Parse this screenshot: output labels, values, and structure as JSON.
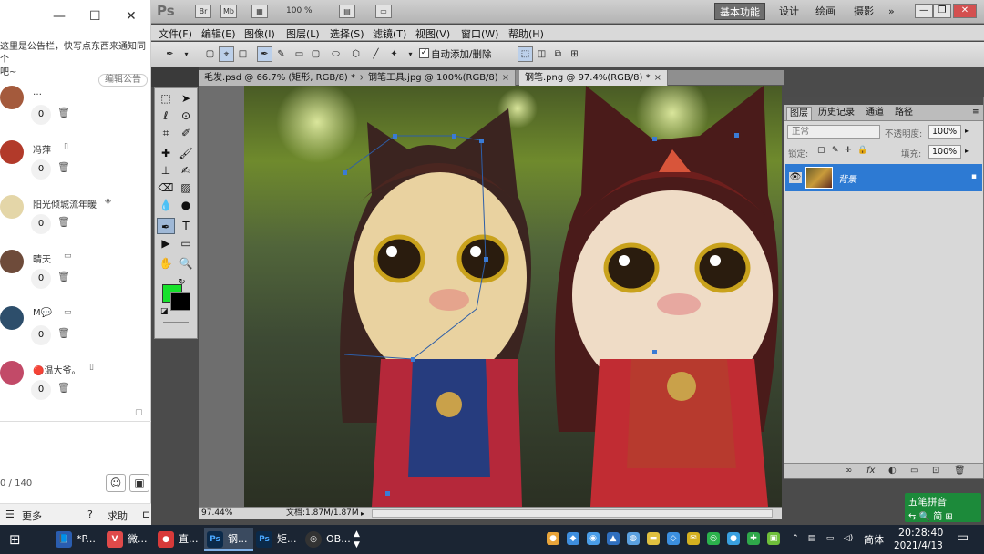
{
  "chat": {
    "window_controls": [
      "—",
      "☐",
      "✕"
    ],
    "notice_line1": "这里是公告栏，快写点东西来通知同个",
    "notice_line2": "吧~",
    "edit_notice": "编辑公告",
    "members": [
      {
        "name": "…",
        "count": "0",
        "avatar_color": "#a45a3c"
      },
      {
        "name": "冯萍",
        "count": "0",
        "avatar_color": "#b23a2a"
      },
      {
        "name": "阳光倾城流年暖",
        "count": "0",
        "avatar_color": "#e4d6a8"
      },
      {
        "name": "晴天",
        "count": "0",
        "avatar_color": "#6e4b3a"
      },
      {
        "name": "M💬",
        "count": "0",
        "avatar_color": "#2d4e6b"
      },
      {
        "name": "🔴温大爷。",
        "count": "0",
        "avatar_color": "#c24a68"
      }
    ],
    "counter": "0 / 140",
    "more_label": "更多",
    "help_label": "求助"
  },
  "ps": {
    "logo": "Ps",
    "appbar_buttons": [
      "Br",
      "Mb"
    ],
    "zoom": "100 %",
    "workspaces": [
      "基本功能",
      "设计",
      "绘画",
      "摄影"
    ],
    "active_workspace": "基本功能",
    "more_ws": "»",
    "window_buttons": [
      "—",
      "❐",
      "✕"
    ],
    "menu": [
      "文件(F)",
      "编辑(E)",
      "图像(I)",
      "图层(L)",
      "选择(S)",
      "滤镜(T)",
      "视图(V)",
      "窗口(W)",
      "帮助(H)"
    ],
    "auto_add_delete": "自动添加/删除",
    "auto_add_checked": "✓",
    "doc_tabs": [
      {
        "label": "毛发.psd @ 66.7% (矩形, RGB/8) *",
        "active": false
      },
      {
        "label": "钢笔工具.jpg @ 100%(RGB/8)",
        "active": false
      },
      {
        "label": "钢笔.png @ 97.4%(RGB/8) *",
        "active": true
      }
    ],
    "tab_close": "×",
    "status_zoom": "97.44%",
    "status_doc": "文档:1.87M/1.87M",
    "fg_color": "#17e22c",
    "bg_color": "#000000"
  },
  "layers": {
    "tabs": [
      "图层",
      "历史记录",
      "通道",
      "路径"
    ],
    "blend_mode": "正常",
    "opacity_label": "不透明度:",
    "opacity": "100%",
    "lock_label": "锁定:",
    "fill_label": "填充:",
    "fill": "100%",
    "layer_name": "背景",
    "footer_icons": [
      "∞",
      "fx",
      "◐",
      "▭",
      "⊡",
      "🗑"
    ]
  },
  "ime": {
    "title": "五笔拼音",
    "row": "⇆ 🔍 简 ⊞"
  },
  "taskbar": {
    "items": [
      {
        "label": "*P...",
        "icon": "📘",
        "icon_bg": "#2a5db0"
      },
      {
        "label": "微...",
        "icon": "V",
        "icon_bg": "#e04a4a"
      },
      {
        "label": "直...",
        "icon": "●",
        "icon_bg": "#d73a3a"
      },
      {
        "label": "钢...",
        "icon": "Ps",
        "icon_bg": "#0b2a4a",
        "active": true
      },
      {
        "label": "矩...",
        "icon": "Ps",
        "icon_bg": "#0b2a4a"
      },
      {
        "label": "OB...",
        "icon": "◎",
        "icon_bg": "#333333"
      }
    ],
    "ime_lang": "简体",
    "time": "20:28:40",
    "date": "2021/4/13"
  }
}
